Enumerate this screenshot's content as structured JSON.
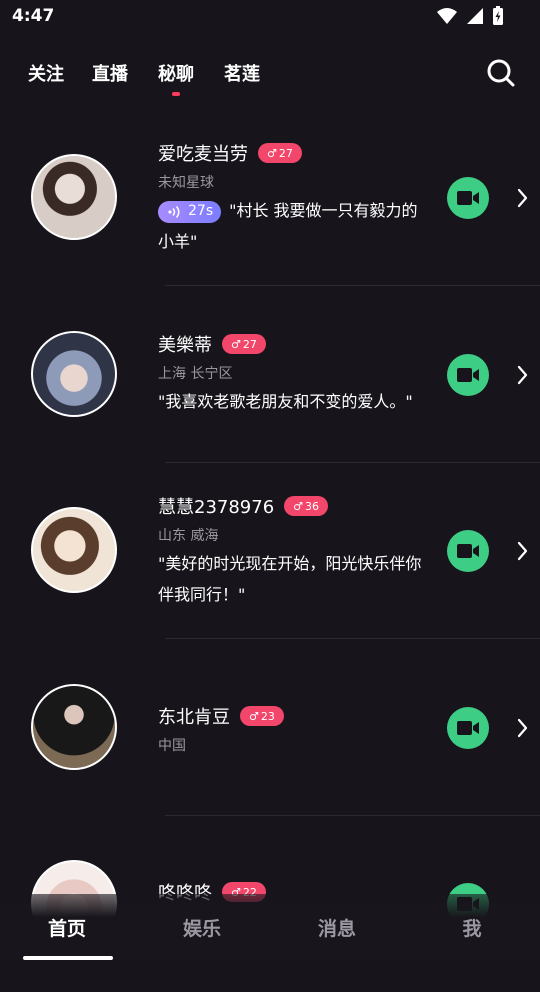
{
  "status_bar": {
    "time": "4:47"
  },
  "top_tabs": [
    {
      "label": "关注"
    },
    {
      "label": "直播"
    },
    {
      "label": "秘聊",
      "active": true
    },
    {
      "label": "茗莲"
    }
  ],
  "users": [
    {
      "name": "爱吃麦当劳",
      "level": "27",
      "location": "未知星球",
      "voice_duration": "27s",
      "bio_line1": "\"村长 我要做一只有毅力的",
      "bio_line2": "小羊\""
    },
    {
      "name": "美樂蒂",
      "level": "27",
      "location": "上海 长宁区",
      "bio_line1": "\"我喜欢老歌老朋友和不变的爱人。\""
    },
    {
      "name": "慧慧2378976",
      "level": "36",
      "location": "山东 威海",
      "bio_line1": "\"美好的时光现在开始，阳光快乐伴你",
      "bio_line2": "伴我同行！\""
    },
    {
      "name": "东北肯豆",
      "level": "23",
      "location": "中国"
    },
    {
      "name": "咚咚咚",
      "level": "22"
    }
  ],
  "bottom_nav": [
    {
      "label": "首页",
      "active": true
    },
    {
      "label": "娱乐"
    },
    {
      "label": "消息"
    },
    {
      "label": "我"
    }
  ],
  "colors": {
    "background": "#17151b",
    "badge": "#f2466b",
    "video_button": "#3ecd84",
    "active_dot": "#ff3b5c"
  }
}
